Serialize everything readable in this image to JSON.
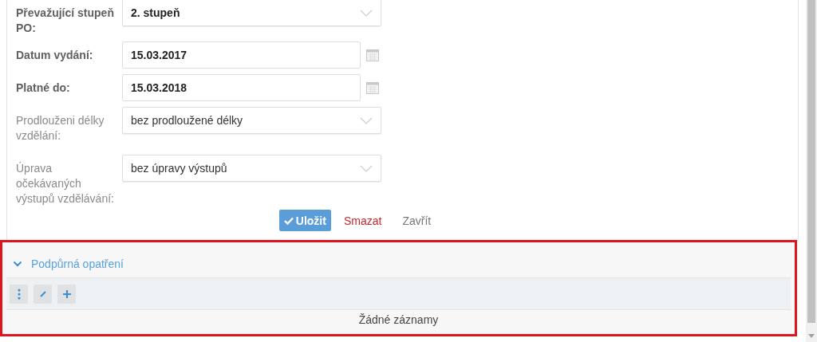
{
  "form": {
    "fields": [
      {
        "label": "Převažující stupeň PO:",
        "required": true,
        "kind": "select",
        "value": "2. stupeň"
      },
      {
        "label": "Datum vydání:",
        "required": true,
        "kind": "date",
        "value": "15.03.2017"
      },
      {
        "label": "Platné do:",
        "required": true,
        "kind": "date",
        "value": "15.03.2018"
      },
      {
        "label": "Prodlouženi délky vzdělání:",
        "required": false,
        "kind": "select",
        "value": "bez prodloužené délky"
      },
      {
        "label": "Úprava očekávaných výstupů vzdělávání:",
        "required": false,
        "kind": "select",
        "value": "bez úpravy výstupů"
      }
    ],
    "buttons": [
      {
        "label": "Uložit",
        "kind": "primary"
      },
      {
        "label": "Smazat",
        "kind": "danger"
      },
      {
        "label": "Zavřít",
        "kind": "link"
      }
    ]
  },
  "section": {
    "title": "Podpůrná opatření",
    "expanded": true,
    "highlighted": true,
    "toolbar": [
      {
        "kind": "menu"
      },
      {
        "kind": "edit"
      },
      {
        "kind": "add"
      }
    ],
    "empty_text": "Žádné záznamy"
  }
}
